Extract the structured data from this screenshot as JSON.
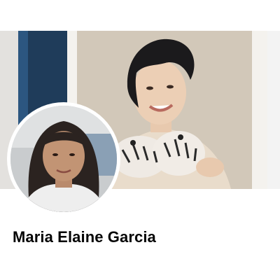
{
  "profile": {
    "name": "Maria Elaine Garcia",
    "cover_photo_icon": "cover-photo",
    "profile_photo_icon": "profile-photo"
  }
}
